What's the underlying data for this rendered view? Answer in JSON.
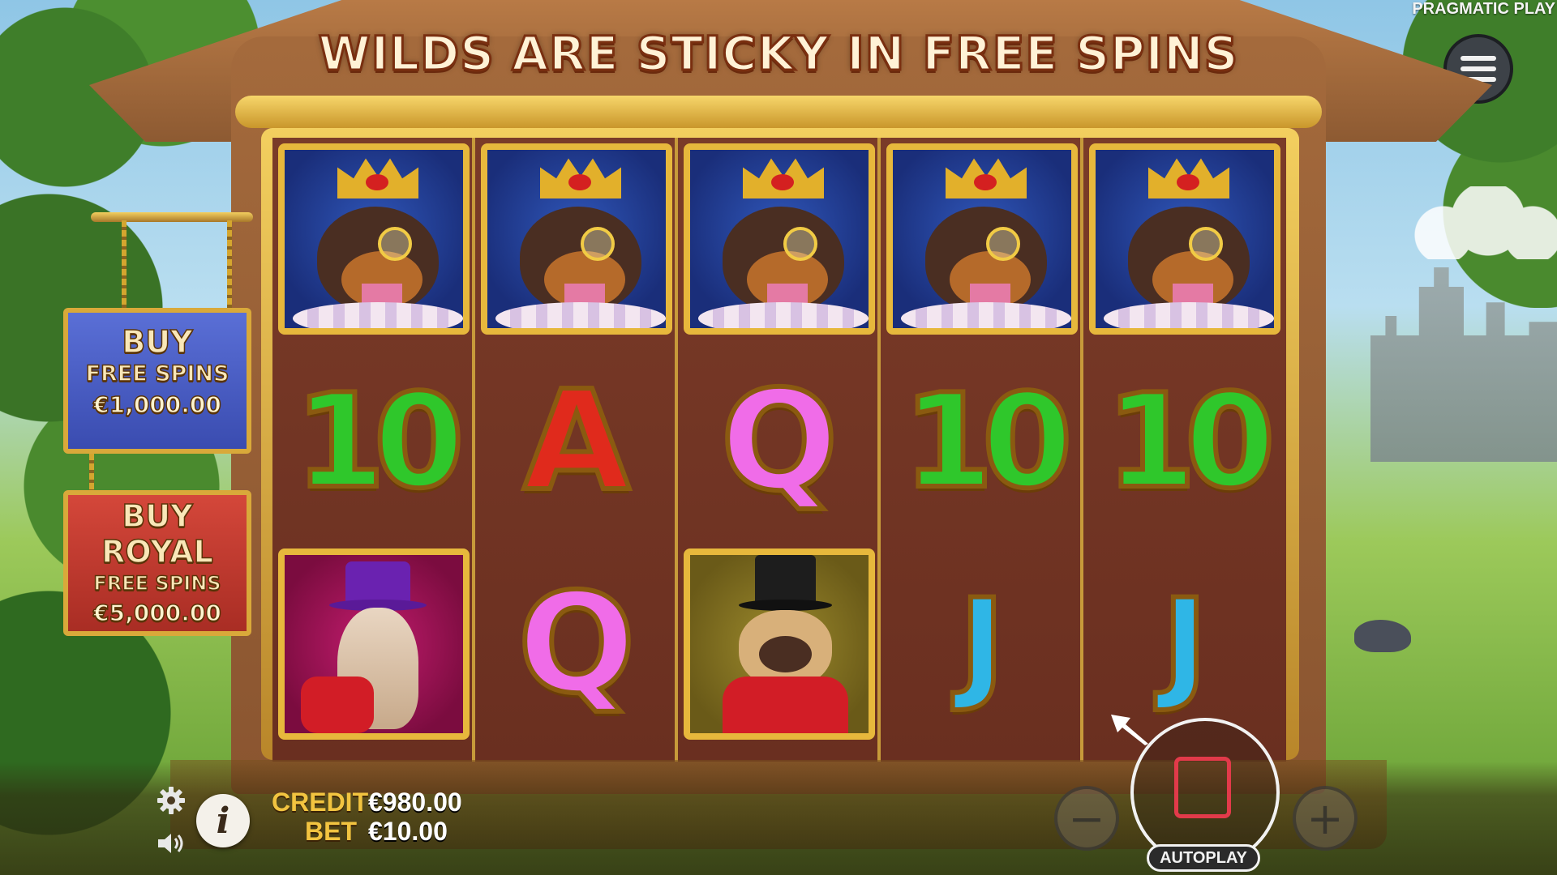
{
  "brand": "PRAGMATIC PLAY",
  "title": "WILDS ARE STICKY IN FREE SPINS",
  "buy_free_spins": {
    "line1": "BUY",
    "line2": "FREE SPINS",
    "price": "€1,000.00"
  },
  "buy_royal": {
    "line1": "BUY",
    "line2": "ROYAL",
    "line3": "FREE SPINS",
    "price": "€5,000.00"
  },
  "reels": [
    {
      "top": "king-wild",
      "middle": "10",
      "bottom": "diva-dog"
    },
    {
      "top": "king-wild",
      "middle": "A",
      "bottom": "Q"
    },
    {
      "top": "king-wild",
      "middle": "Q",
      "bottom": "pug-dog"
    },
    {
      "top": "king-wild",
      "middle": "10",
      "bottom": "J"
    },
    {
      "top": "king-wild",
      "middle": "10",
      "bottom": "J"
    }
  ],
  "meters": {
    "credit_label": "CREDIT",
    "credit_value": "€980.00",
    "bet_label": "BET",
    "bet_value": "€10.00"
  },
  "controls": {
    "autoplay": "AUTOPLAY",
    "minus": "−",
    "plus": "+",
    "info": "i"
  },
  "colors": {
    "ten": "#2fc72b",
    "ace": "#e02a1c",
    "queen": "#f06ce8",
    "jack": "#2fb6e6",
    "stop": "#e23a4a",
    "meter_label": "#f2c440"
  }
}
